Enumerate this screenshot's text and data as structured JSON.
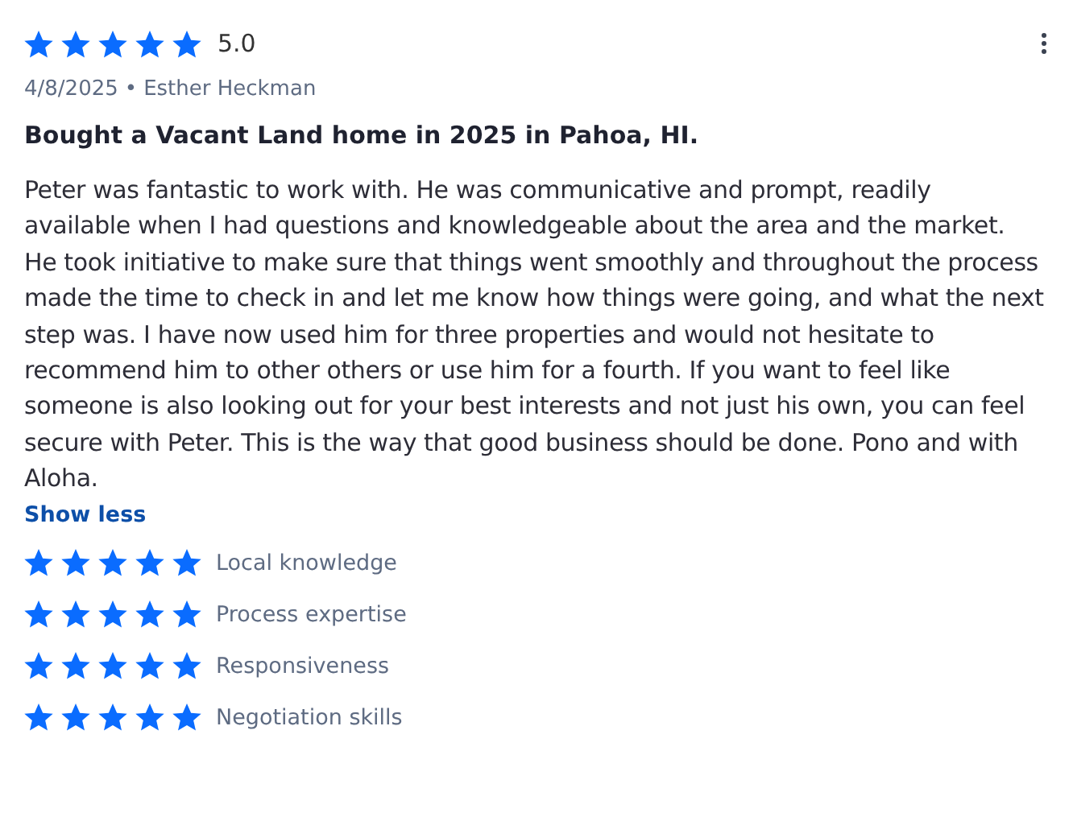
{
  "review": {
    "stars": 5,
    "score": "5.0",
    "date": "4/8/2025",
    "separator": "•",
    "author": "Esther Heckman",
    "title": "Bought a Vacant Land home in 2025 in Pahoa, HI.",
    "body": "Peter was fantastic to work with. He was communicative and prompt, readily available when I had questions and knowledgeable about the area and the market. He took initiative to make sure that things went smoothly and throughout the process made the time to check in and let me know how things were going, and what the next step was. I have now used him for three properties and would not hesitate to recommend him to other others or use him for a fourth. If you want to feel like someone is also looking out for your best interests and not just his own, you can feel secure with Peter. This is the way that good business should be done. Pono and with Aloha.",
    "toggle": "Show less"
  },
  "categories": [
    {
      "label": "Local knowledge",
      "stars": 5
    },
    {
      "label": "Process expertise",
      "stars": 5
    },
    {
      "label": "Responsiveness",
      "stars": 5
    },
    {
      "label": "Negotiation skills",
      "stars": 5
    }
  ]
}
